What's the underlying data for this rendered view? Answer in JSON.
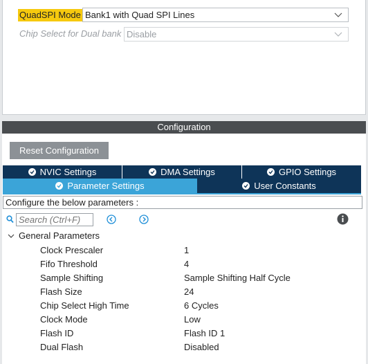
{
  "mode": {
    "quadspi_label": "QuadSPI Mode",
    "quadspi_value": "Bank1 with Quad SPI Lines",
    "chip_select_label": "Chip Select for Dual bank",
    "chip_select_value": "Disable"
  },
  "configuration": {
    "header": "Configuration",
    "reset_label": "Reset Configuration",
    "tabs_row1": [
      "NVIC Settings",
      "DMA Settings",
      "GPIO Settings"
    ],
    "tabs_row2": [
      "Parameter Settings",
      "User Constants"
    ],
    "active_tab": "Parameter Settings",
    "description": "Configure the below parameters :",
    "search_placeholder": "Search (Ctrl+F)",
    "group_label": "General Parameters",
    "parameters": [
      {
        "name": "Clock Prescaler",
        "value": "1"
      },
      {
        "name": "Fifo Threshold",
        "value": "4"
      },
      {
        "name": "Sample Shifting",
        "value": "Sample Shifting Half Cycle"
      },
      {
        "name": "Flash Size",
        "value": "24"
      },
      {
        "name": "Chip Select High Time",
        "value": "6 Cycles"
      },
      {
        "name": "Clock Mode",
        "value": "Low"
      },
      {
        "name": "Flash ID",
        "value": "Flash ID 1"
      },
      {
        "name": "Dual Flash",
        "value": "Disabled"
      }
    ]
  },
  "colors": {
    "highlight": "#f6c90e",
    "header_bg": "#4a4d50",
    "tab_dark": "#0e3458",
    "tab_active": "#3ba4d8",
    "button_gray": "#8c9196",
    "nav_blue": "#1f8fd8"
  },
  "icons": {
    "chevron": "chevron-down-icon",
    "check": "check-circle-icon",
    "search": "search-icon",
    "prev": "arrow-left-circle-icon",
    "next": "arrow-right-circle-icon",
    "info": "info-icon",
    "collapse": "chevron-down-icon"
  }
}
